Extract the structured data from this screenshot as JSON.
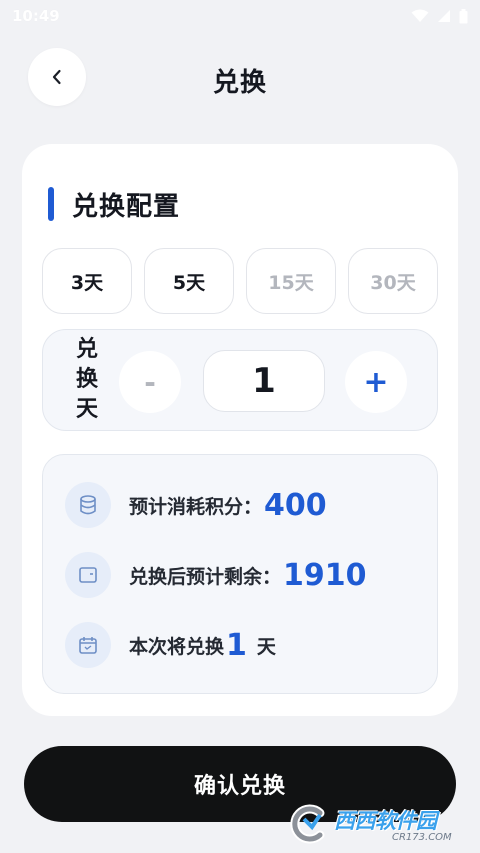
{
  "status_bar": {
    "time": "10:49"
  },
  "header": {
    "title": "兑换"
  },
  "section": {
    "title": "兑换配置"
  },
  "day_options": [
    {
      "label": "3天",
      "enabled": true
    },
    {
      "label": "5天",
      "enabled": true
    },
    {
      "label": "15天",
      "enabled": false
    },
    {
      "label": "30天",
      "enabled": false
    }
  ],
  "stepper": {
    "label": "兑换天",
    "minus": "-",
    "plus": "+",
    "value": "1"
  },
  "summary": {
    "cost_label": "预计消耗积分：",
    "cost_value": "400",
    "remain_label": "兑换后预计剩余：",
    "remain_value": "1910",
    "days_prefix": "本次将兑换",
    "days_value": "1",
    "days_suffix": "天"
  },
  "confirm": {
    "label": "确认兑换"
  },
  "watermark": {
    "text": "西西软件园",
    "sub": "CR173.COM"
  },
  "colors": {
    "accent": "#1f5bd3",
    "background": "#f1f2f5",
    "button": "#111213"
  }
}
